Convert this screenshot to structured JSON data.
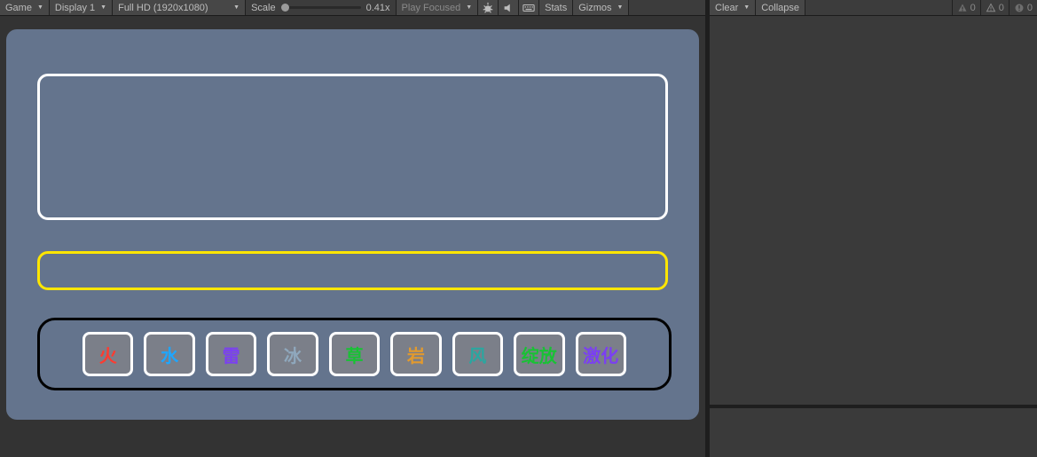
{
  "toolbar": {
    "view_mode": "Game",
    "display": "Display 1",
    "resolution": "Full HD (1920x1080)",
    "scale_label": "Scale",
    "scale_value": "0.41x",
    "play_mode": "Play Focused",
    "stats": "Stats",
    "gizmos": "Gizmos"
  },
  "console": {
    "clear": "Clear",
    "collapse": "Collapse",
    "info_count": "0",
    "warn_count": "0",
    "error_count": "0"
  },
  "game": {
    "chips": [
      {
        "label": "火",
        "color": "#ff3b30"
      },
      {
        "label": "水",
        "color": "#1fa6ff"
      },
      {
        "label": "雷",
        "color": "#7b3ff2"
      },
      {
        "label": "冰",
        "color": "#8fa8bd"
      },
      {
        "label": "草",
        "color": "#18c234"
      },
      {
        "label": "岩",
        "color": "#e29a2e"
      },
      {
        "label": "风",
        "color": "#2aa7a0"
      },
      {
        "label": "绽放",
        "color": "#18c234"
      },
      {
        "label": "激化",
        "color": "#7b3ff2"
      }
    ]
  },
  "icons": {
    "bug": "bug-icon",
    "audio": "audio-icon",
    "keyboard": "keyboard-icon"
  }
}
